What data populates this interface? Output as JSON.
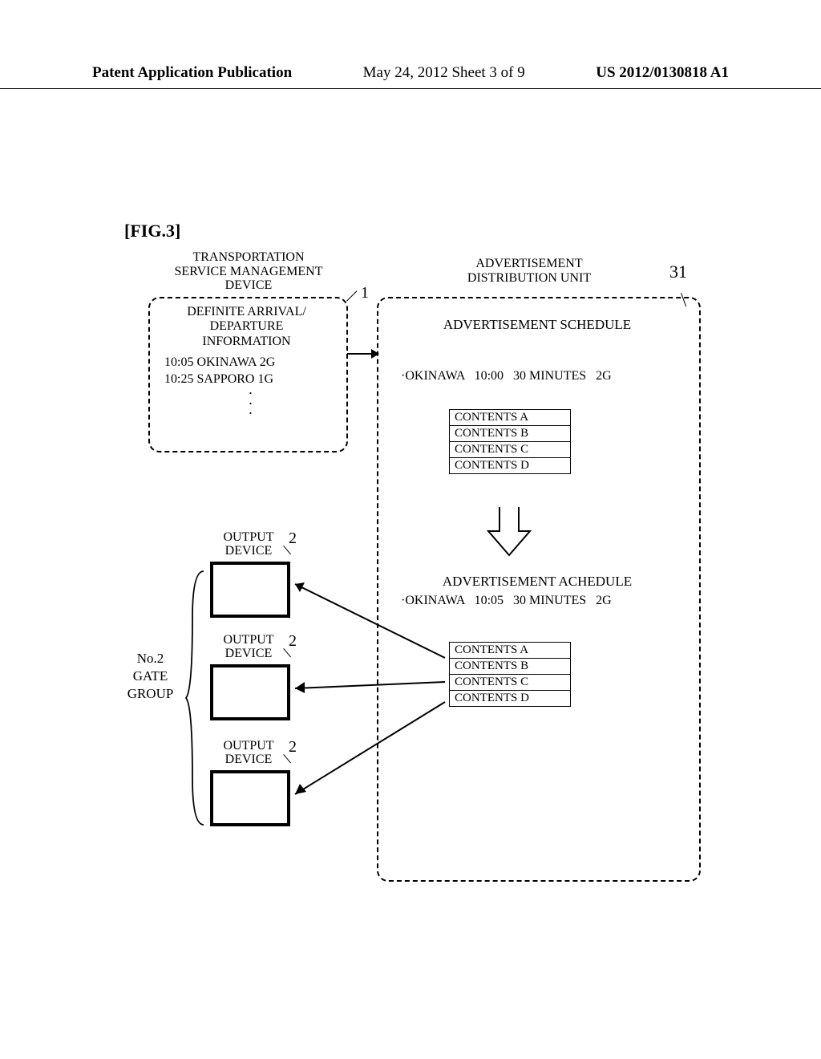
{
  "header": {
    "left": "Patent Application Publication",
    "mid": "May 24, 2012  Sheet 3 of 9",
    "right": "US 2012/0130818 A1"
  },
  "figure_label": "[FIG.3]",
  "tsm": {
    "title": "TRANSPORTATION\nSERVICE MANAGEMENT\nDEVICE",
    "ref": "1",
    "subtitle": "DEFINITE ARRIVAL/\nDEPARTURE\nINFORMATION",
    "rows": [
      "10:05  OKINAWA   2G",
      "10:25  SAPPORO    1G"
    ]
  },
  "adu": {
    "title": "ADVERTISEMENT\nDISTRIBUTION UNIT",
    "ref": "31",
    "schedule1_title": "ADVERTISEMENT SCHEDULE",
    "schedule1_line": "·OKINAWA   10:00   30 MINUTES   2G",
    "contents1": [
      "CONTENTS A",
      "CONTENTS B",
      "CONTENTS C",
      "CONTENTS D"
    ],
    "schedule2_title": "ADVERTISEMENT ACHEDULE",
    "schedule2_line": "·OKINAWA   10:05   30 MINUTES   2G",
    "contents2": [
      "CONTENTS A",
      "CONTENTS B",
      "CONTENTS C",
      "CONTENTS D"
    ]
  },
  "outputs": {
    "label": "OUTPUT\nDEVICE",
    "ref": "2",
    "gate_label": "No.2\nGATE\nGROUP"
  }
}
